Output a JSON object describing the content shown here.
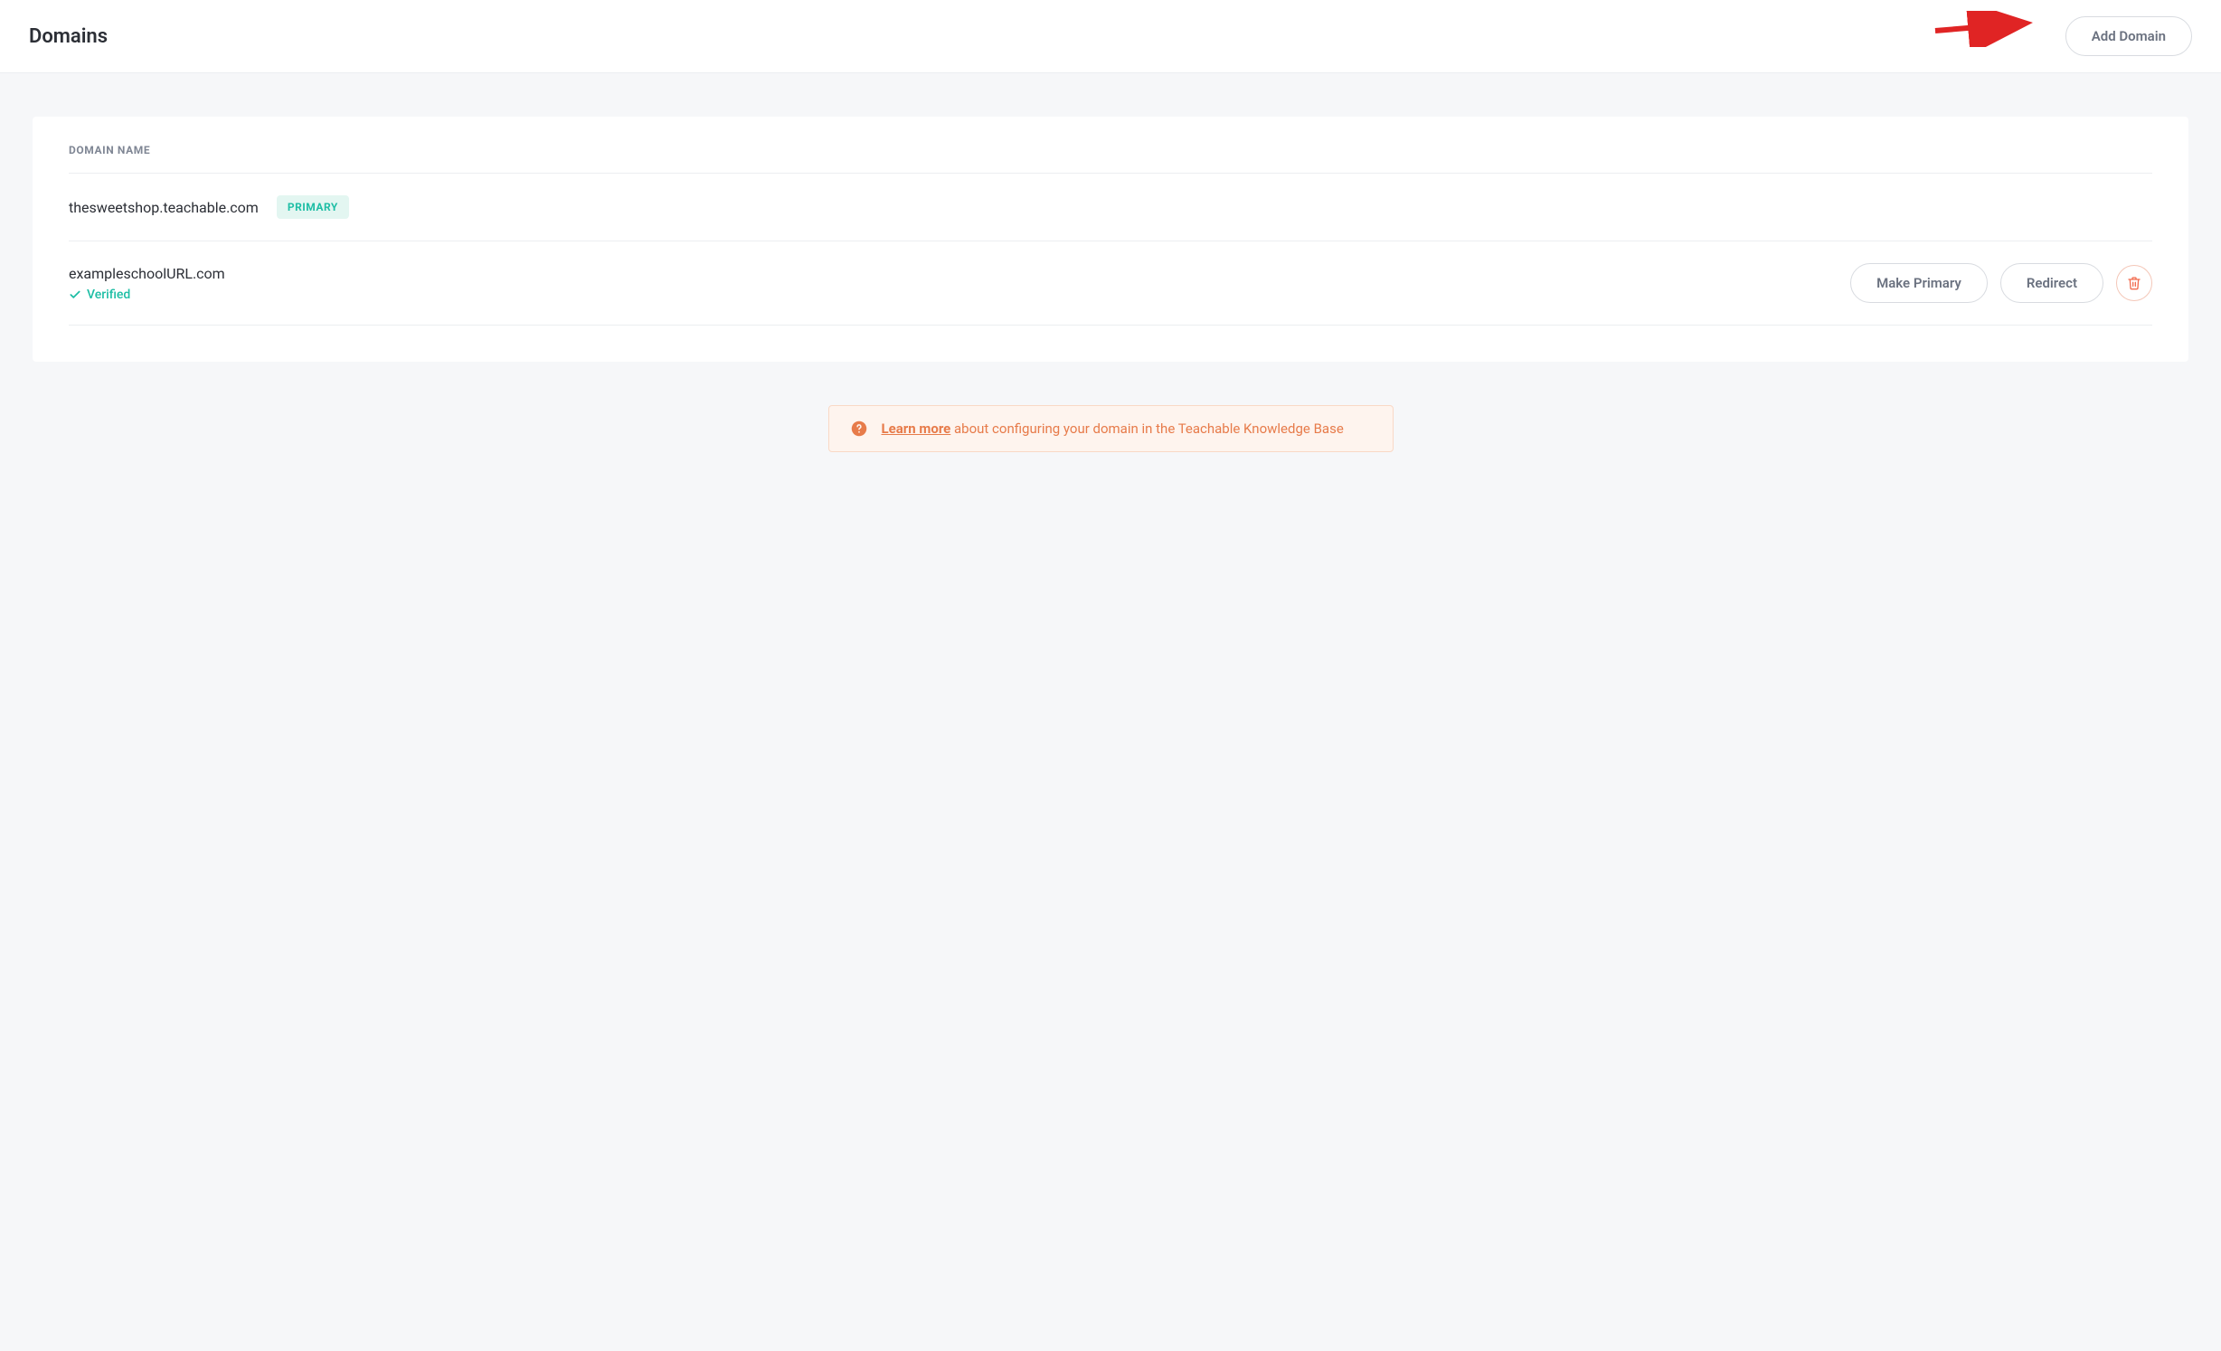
{
  "header": {
    "title": "Domains",
    "add_button": "Add Domain"
  },
  "table": {
    "column_header": "DOMAIN NAME",
    "rows": [
      {
        "domain": "thesweetshop.teachable.com",
        "primary_badge": "PRIMARY",
        "is_primary": true
      },
      {
        "domain": "exampleschoolURL.com",
        "verified_label": "Verified",
        "is_primary": false,
        "actions": {
          "make_primary": "Make Primary",
          "redirect": "Redirect"
        }
      }
    ]
  },
  "banner": {
    "learn_more_link": "Learn more",
    "text_suffix": " about configuring your domain in the Teachable Knowledge Base"
  }
}
